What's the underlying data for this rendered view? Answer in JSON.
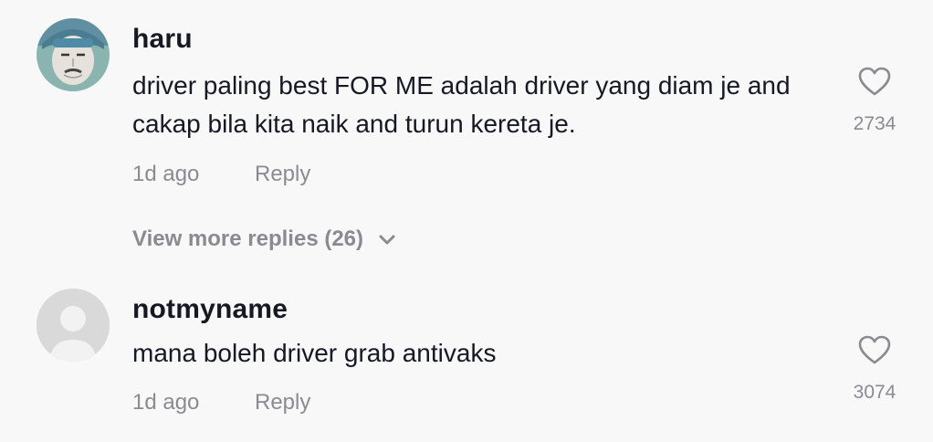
{
  "comments": [
    {
      "username": "haru",
      "text": "driver paling best FOR ME adalah driver yang diam je and cakap bila kita naik and turun kereta je.",
      "time": "1d ago",
      "reply_label": "Reply",
      "likes": "2734",
      "avatar_icon": "user-photo-avatar"
    },
    {
      "username": "notmyname",
      "text": "mana boleh driver grab antivaks",
      "time": "1d ago",
      "reply_label": "Reply",
      "likes": "3074",
      "avatar_icon": "default-user-avatar"
    }
  ],
  "view_more_replies": "View more replies (26)",
  "colors": {
    "background": "#f8f8f8",
    "primary_text": "#161823",
    "secondary_text": "#8a8b91",
    "default_avatar": "#d9d9d9"
  }
}
